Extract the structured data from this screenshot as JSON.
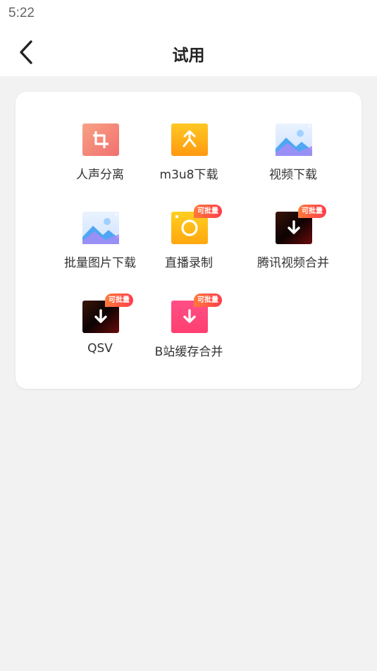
{
  "status_bar": {
    "time": "5:22"
  },
  "header": {
    "title": "试用"
  },
  "tools": [
    {
      "label": "人声分离",
      "icon": "crop-icon",
      "badge": ""
    },
    {
      "label": "m3u8下载",
      "icon": "merge-arrow-icon",
      "badge": ""
    },
    {
      "label": "视频下载",
      "icon": "image-icon",
      "badge": ""
    },
    {
      "label": "批量图片下载",
      "icon": "image-icon",
      "badge": ""
    },
    {
      "label": "直播录制",
      "icon": "record-icon",
      "badge": "可批量"
    },
    {
      "label": "腾讯视频合并",
      "icon": "download-icon",
      "badge": "可批量"
    },
    {
      "label": "QSV",
      "icon": "download-icon",
      "badge": "可批量"
    },
    {
      "label": "B站缓存合并",
      "icon": "download-icon",
      "badge": "可批量"
    }
  ],
  "colors": {
    "background": "#f2f2f2",
    "card": "#ffffff",
    "badge_start": "#ff7a3a",
    "badge_end": "#ff3c4c"
  }
}
